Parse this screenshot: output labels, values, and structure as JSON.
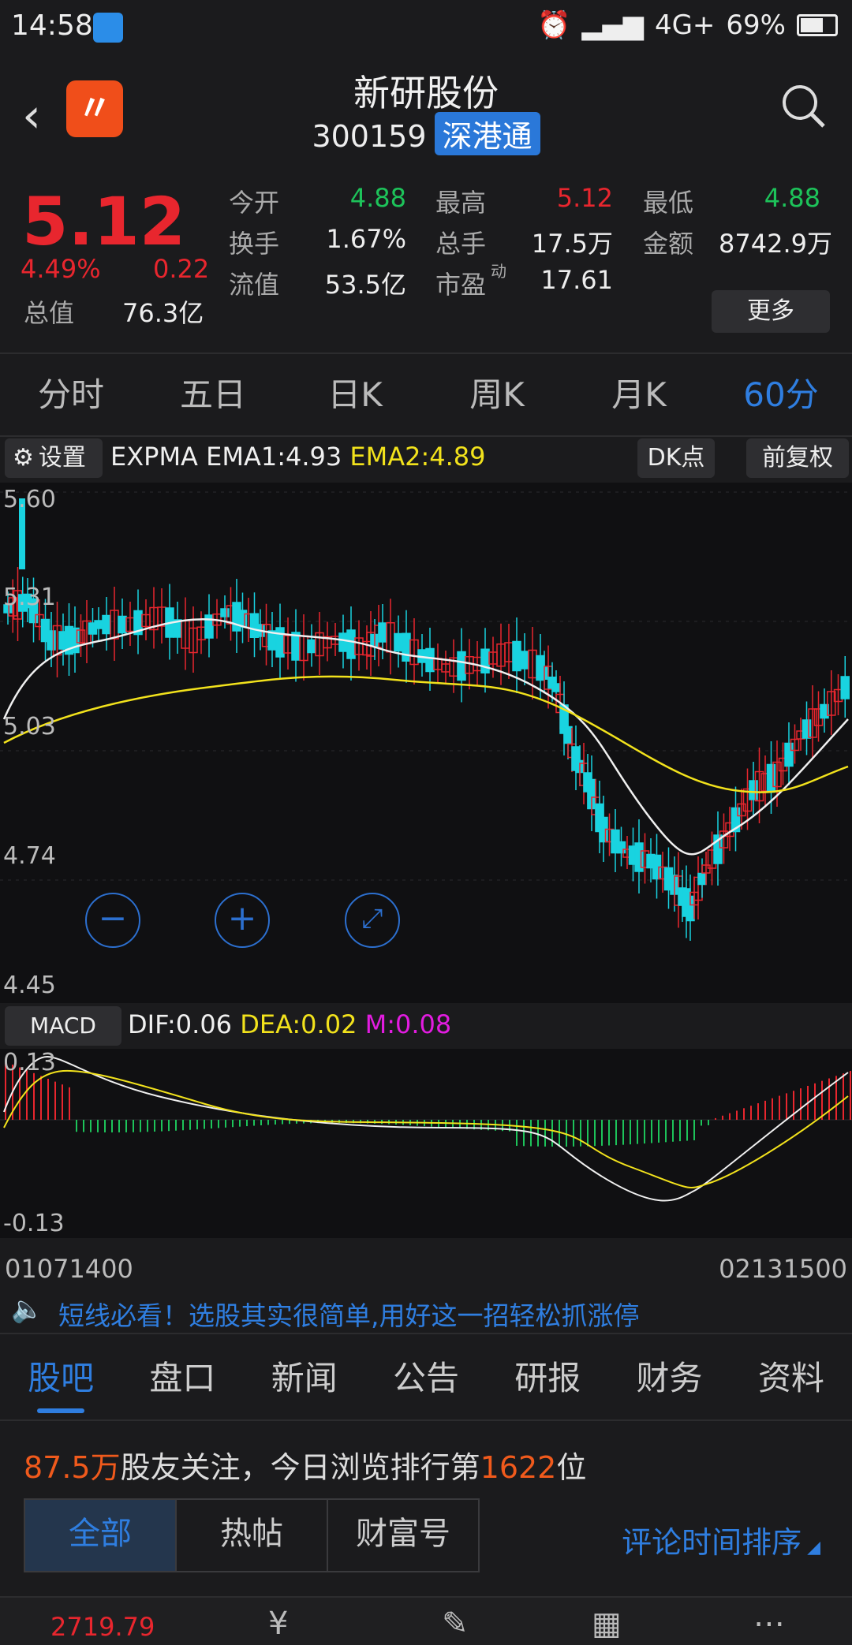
{
  "status_bar": {
    "time": "14:58",
    "network": "4G+",
    "battery": "69%"
  },
  "header": {
    "name": "新研股份",
    "code": "300159",
    "badge": "深港通"
  },
  "quote": {
    "price": "5.12",
    "change_pct": "4.49%",
    "change": "0.22",
    "total_value_label": "总值",
    "total_value": "76.3亿",
    "cells": [
      {
        "label": "今开",
        "value": "4.88",
        "color": "green"
      },
      {
        "label": "最高",
        "value": "5.12",
        "color": "red"
      },
      {
        "label": "最低",
        "value": "4.88",
        "color": "green"
      },
      {
        "label": "换手",
        "value": "1.67%",
        "color": "white"
      },
      {
        "label": "总手",
        "value": "17.5万",
        "color": "white"
      },
      {
        "label": "金额",
        "value": "8742.9万",
        "color": "white"
      },
      {
        "label": "流值",
        "value": "53.5亿",
        "color": "white"
      },
      {
        "label": "市盈",
        "value": "17.61",
        "color": "white",
        "sup": "动"
      }
    ],
    "more_label": "更多"
  },
  "period_tabs": [
    "分时",
    "五日",
    "日K",
    "周K",
    "月K",
    "60分"
  ],
  "active_period": 5,
  "indicator": {
    "settings_label": "设置",
    "expma_label": "EXPMA",
    "ema1": "EMA1:4.93",
    "ema2": "EMA2:4.89",
    "dk_label": "DK点",
    "adjust_label": "前复权"
  },
  "kline_axis": [
    "5.60",
    "5.31",
    "5.03",
    "4.74",
    "4.45"
  ],
  "macd": {
    "label": "MACD",
    "dif": "DIF:0.06",
    "dea": "DEA:0.02",
    "m": "M:0.08",
    "axis_top": "0.13",
    "axis_bottom": "-0.13"
  },
  "x_labels": {
    "start": "01071400",
    "end": "02131500"
  },
  "ad_text": "短线必看！选股其实很简单,用好这一招轻松抓涨停",
  "bottom_tabs": [
    "股吧",
    "盘口",
    "新闻",
    "公告",
    "研报",
    "财务",
    "资料"
  ],
  "follow": {
    "count": "87.5万",
    "text1": "股友关注，今日浏览排行第",
    "rank": "1622",
    "text2": "位"
  },
  "filters": [
    "全部",
    "热帖",
    "财富号"
  ],
  "sort_label": "评论时间排序",
  "bottom_nav": {
    "index_value": "2719.79"
  },
  "colors": {
    "up": "#e8262e",
    "down": "#19d3e0",
    "accent": "#2f7ee0",
    "ema2": "#f2e21c"
  }
}
